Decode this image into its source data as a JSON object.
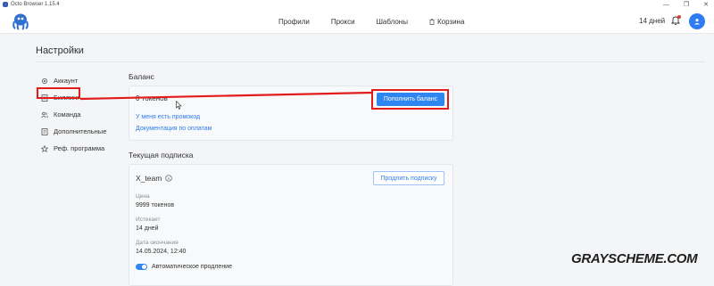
{
  "window": {
    "title": "Octo Browser 1.15.4",
    "controls": [
      "—",
      "❐",
      "✕"
    ]
  },
  "header": {
    "nav": [
      "Профили",
      "Прокси",
      "Шаблоны",
      "Корзина"
    ],
    "days_left": "14 дней",
    "accent_color": "#2f86f0"
  },
  "page": {
    "title": "Настройки"
  },
  "sidebar": {
    "items": [
      {
        "label": "Аккаунт",
        "icon": "gear-icon"
      },
      {
        "label": "Биллинг",
        "icon": "billing-icon"
      },
      {
        "label": "Команда",
        "icon": "team-icon"
      },
      {
        "label": "Дополнительные",
        "icon": "list-icon"
      },
      {
        "label": "Реф. программа",
        "icon": "star-icon"
      }
    ]
  },
  "balance": {
    "section_title": "Баланс",
    "tokens": "0 токенов",
    "promo_link": "У меня есть промокод",
    "docs_link": "Документация по оплатам",
    "topup_button": "Пополнить баланс"
  },
  "subscription": {
    "section_title": "Текущая подписка",
    "name": "X_team",
    "extend_button": "Продлить подписку",
    "price_label": "Цена",
    "price_value": "9999 токенов",
    "expires_label": "Истекает",
    "expires_value": "14 дней",
    "end_date_label": "Дата окончания",
    "end_date_value": "14.05.2024, 12:40",
    "auto_renew_label": "Автоматическое продление",
    "auto_renew_on": true
  },
  "annotation": {
    "highlight_color": "#e21b1b"
  },
  "watermark": "GRAYSCHEME.COM"
}
